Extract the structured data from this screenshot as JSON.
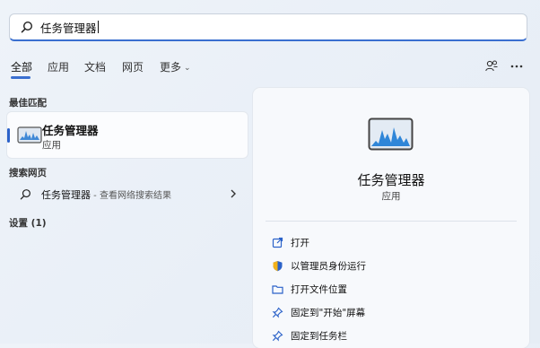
{
  "search": {
    "query": "任务管理器"
  },
  "tabs": [
    {
      "label": "全部",
      "active": true
    },
    {
      "label": "应用"
    },
    {
      "label": "文档"
    },
    {
      "label": "网页"
    },
    {
      "label": "更多"
    }
  ],
  "sections": {
    "best_match": "最佳匹配",
    "search_web": "搜索网页",
    "settings": "设置 (1)"
  },
  "best_match": {
    "title": "任务管理器",
    "subtitle": "应用",
    "icon": "task-manager-icon"
  },
  "web_result": {
    "query": "任务管理器",
    "suffix": " - 查看网络搜索结果"
  },
  "preview": {
    "title": "任务管理器",
    "subtitle": "应用",
    "actions": [
      {
        "label": "打开",
        "icon": "open-icon"
      },
      {
        "label": "以管理员身份运行",
        "icon": "admin-shield-icon"
      },
      {
        "label": "打开文件位置",
        "icon": "folder-icon"
      },
      {
        "label": "固定到\"开始\"屏幕",
        "icon": "pin-icon"
      },
      {
        "label": "固定到任务栏",
        "icon": "pin-icon"
      }
    ]
  },
  "colors": {
    "accent": "#3a6fd0",
    "icon_blue": "#2b62c9"
  }
}
